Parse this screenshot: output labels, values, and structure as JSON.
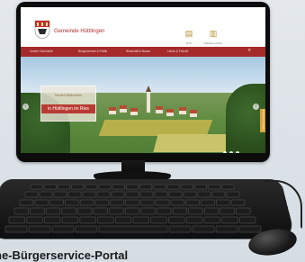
{
  "site": {
    "title": "Gemeinde Hüttlingen",
    "header_icons": [
      {
        "icon": "calendar-icon",
        "label": "ETS"
      },
      {
        "icon": "document-icon",
        "label": "Rathaus Online"
      }
    ],
    "nav": [
      "Unsere Gemeinde",
      "Bürgerservice & Politik",
      "Wirtschaft & Bauen",
      "Leben & Freizeit"
    ],
    "hero": {
      "subtitle": "Herzlich Willkommen",
      "title": "in Hüttlingen im Ries"
    },
    "side_tab": "Online-Formulare"
  },
  "caption": "ne-Bürgerservice-Portal",
  "colors": {
    "nav": "#a52a2a",
    "accent": "#b83b33",
    "gold": "#d9a43a"
  }
}
